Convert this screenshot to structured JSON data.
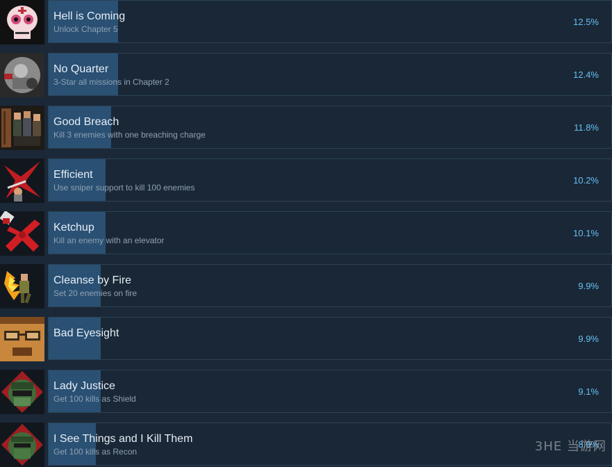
{
  "achievements": [
    {
      "title": "Hell is Coming",
      "desc": "Unlock Chapter 5",
      "percent": "12.5%",
      "fill": 12.5,
      "icon": "sugar-skull-icon",
      "icon_color": "#d14b7c"
    },
    {
      "title": "No Quarter",
      "desc": "3-Star all missions in Chapter 2",
      "percent": "12.4%",
      "fill": 12.4,
      "icon": "grey-soldier-icon",
      "icon_color": "#8a8a8a"
    },
    {
      "title": "Good Breach",
      "desc": "Kill 3 enemies with one breaching charge",
      "percent": "11.8%",
      "fill": 11.8,
      "icon": "breach-squad-icon",
      "icon_color": "#8a5a3c"
    },
    {
      "title": "Efficient",
      "desc": "Use sniper support to kill 100 enemies",
      "percent": "10.2%",
      "fill": 10.2,
      "icon": "sniper-icon",
      "icon_color": "#c01e22"
    },
    {
      "title": "Ketchup",
      "desc": "Kill an enemy with an elevator",
      "percent": "10.1%",
      "fill": 10.1,
      "icon": "elevator-splat-icon",
      "icon_color": "#c01e22"
    },
    {
      "title": "Cleanse by Fire",
      "desc": "Set 20 enemies on fire",
      "percent": "9.9%",
      "fill": 9.9,
      "icon": "flame-icon",
      "icon_color": "#f2a21b"
    },
    {
      "title": "Bad Eyesight",
      "desc": "",
      "percent": "9.9%",
      "fill": 9.9,
      "icon": "glasses-face-icon",
      "icon_color": "#c8873c"
    },
    {
      "title": "Lady Justice",
      "desc": "Get 100 kills as Shield",
      "percent": "9.1%",
      "fill": 9.1,
      "icon": "shield-soldier-icon",
      "icon_color": "#3f6b3a"
    },
    {
      "title": "I See Things and I Kill Them",
      "desc": "Get 100 kills as Recon",
      "percent": "8.9%",
      "fill": 8.9,
      "icon": "recon-soldier-icon",
      "icon_color": "#3f6b3a"
    }
  ],
  "watermark": "3HE 当游网"
}
